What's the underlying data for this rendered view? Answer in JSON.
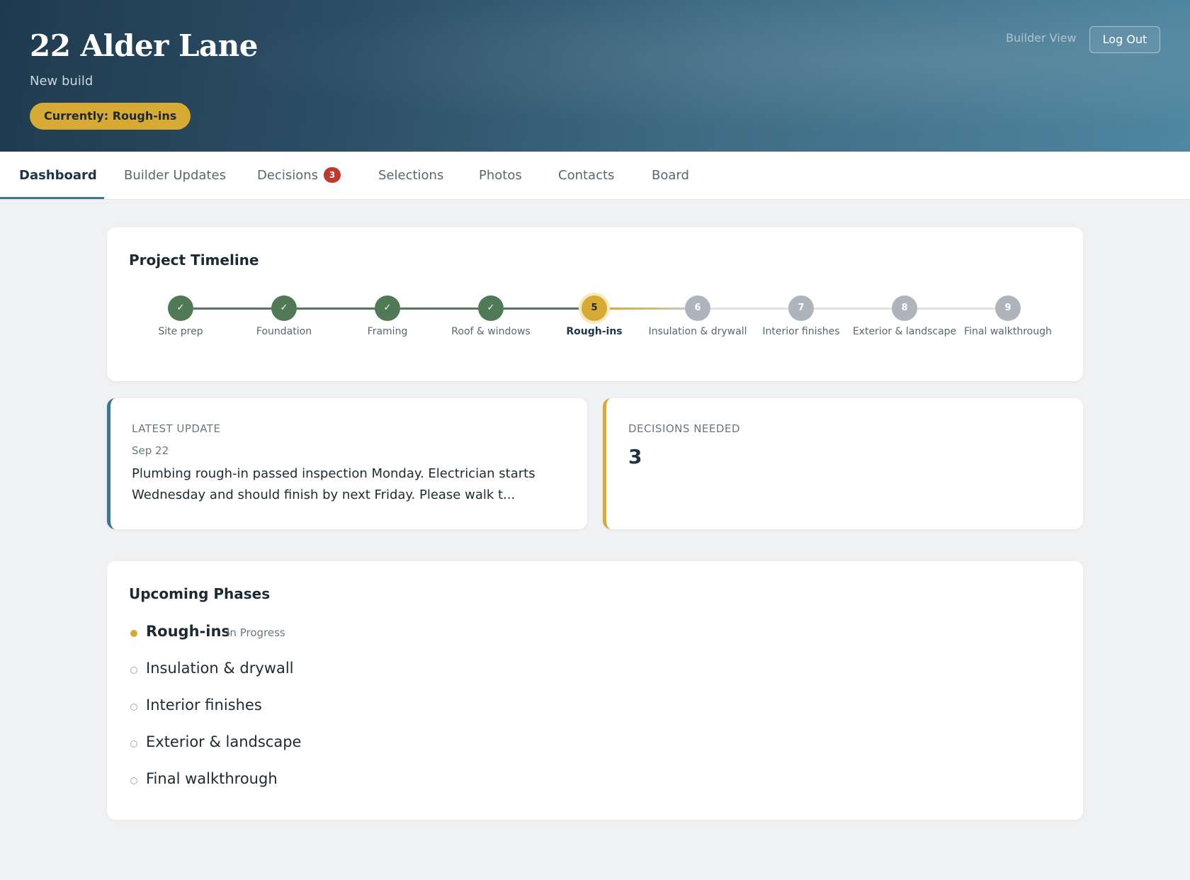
{
  "header": {
    "title": "22 Alder Lane",
    "subtitle": "New build",
    "phase_pill": "Currently: Rough-ins",
    "view_label": "Builder View",
    "logout_label": "Log Out"
  },
  "tabs": [
    {
      "label": "Dashboard",
      "active": true
    },
    {
      "label": "Builder Updates"
    },
    {
      "label": "Decisions",
      "badge": "3"
    },
    {
      "label": "Selections"
    },
    {
      "label": "Photos"
    },
    {
      "label": "Contacts"
    },
    {
      "label": "Board"
    }
  ],
  "timeline": {
    "title": "Project Timeline",
    "steps": [
      {
        "marker": "✓",
        "label": "Site prep",
        "status": "done"
      },
      {
        "marker": "✓",
        "label": "Foundation",
        "status": "done"
      },
      {
        "marker": "✓",
        "label": "Framing",
        "status": "done"
      },
      {
        "marker": "✓",
        "label": "Roof & windows",
        "status": "done"
      },
      {
        "marker": "5",
        "label": "Rough-ins",
        "status": "current"
      },
      {
        "marker": "6",
        "label": "Insulation & drywall",
        "status": "pending"
      },
      {
        "marker": "7",
        "label": "Interior finishes",
        "status": "pending"
      },
      {
        "marker": "8",
        "label": "Exterior & landscape",
        "status": "pending"
      },
      {
        "marker": "9",
        "label": "Final walkthrough",
        "status": "pending"
      }
    ]
  },
  "latest_update": {
    "eyebrow": "LATEST UPDATE",
    "date": "Sep 22",
    "text": "Plumbing rough-in passed inspection Monday. Electrician starts Wednesday and should finish by next Friday. Please walk t..."
  },
  "decisions": {
    "eyebrow": "DECISIONS NEEDED",
    "count": "3"
  },
  "upcoming": {
    "title": "Upcoming Phases",
    "items": [
      {
        "name": "Rough-ins",
        "status": "In Progress",
        "current": true
      },
      {
        "name": "Insulation & drywall"
      },
      {
        "name": "Interior finishes"
      },
      {
        "name": "Exterior & landscape"
      },
      {
        "name": "Final walkthrough"
      }
    ]
  },
  "colors": {
    "accent_blue": "#3d7592",
    "accent_gold": "#d7aa33",
    "done_green": "#4f7a55",
    "badge_red": "#c0392b"
  }
}
